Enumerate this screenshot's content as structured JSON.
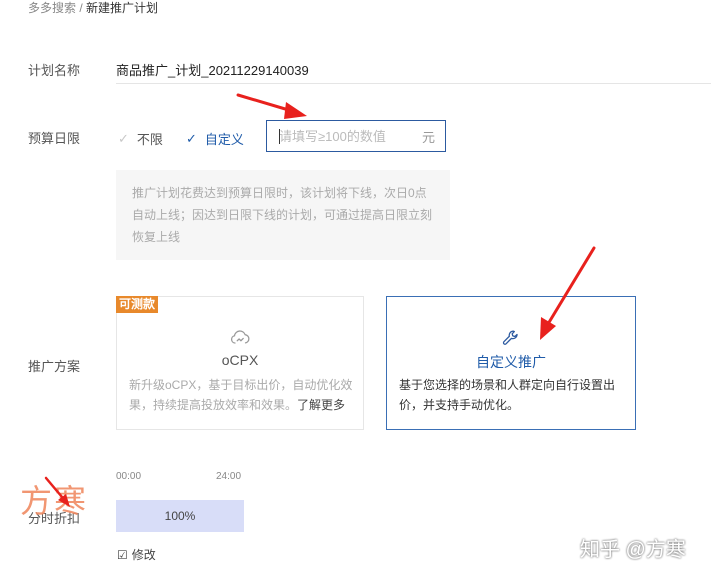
{
  "breadcrumb": {
    "parent": "多多搜索 /",
    "current": "新建推广计划"
  },
  "plan_name": {
    "label": "计划名称",
    "value": "商品推广_计划_20211229140039"
  },
  "budget": {
    "label": "预算日限",
    "option_unlimited": "不限",
    "option_custom": "自定义",
    "input_placeholder": "请填写≥100的数值",
    "unit": "元",
    "note": "推广计划花费达到预算日限时，该计划将下线，次日0点自动上线；因达到日限下线的计划，可通过提高日限立刻恢复上线"
  },
  "promotion_plan": {
    "label": "推广方案",
    "ocpx": {
      "badge": "可测款",
      "title": "oCPX",
      "desc": "新升级oCPX，基于目标出价，自动优化效果，持续提高投放效率和效果。",
      "more": "了解更多"
    },
    "custom": {
      "title": "自定义推广",
      "desc": "基于您选择的场景和人群定向自行设置出价，并支持手动优化。"
    }
  },
  "time_discount": {
    "label": "分时折扣",
    "time_start": "00:00",
    "time_end": "24:00",
    "value": "100%",
    "modify": "修改"
  },
  "watermarks": {
    "script": "方寒",
    "zhihu": "知乎 @方寒"
  },
  "colors": {
    "accent": "#1f5ba9",
    "badge": "#e8892b",
    "arrow": "#e8211d",
    "bar": "#d8ddf8"
  }
}
